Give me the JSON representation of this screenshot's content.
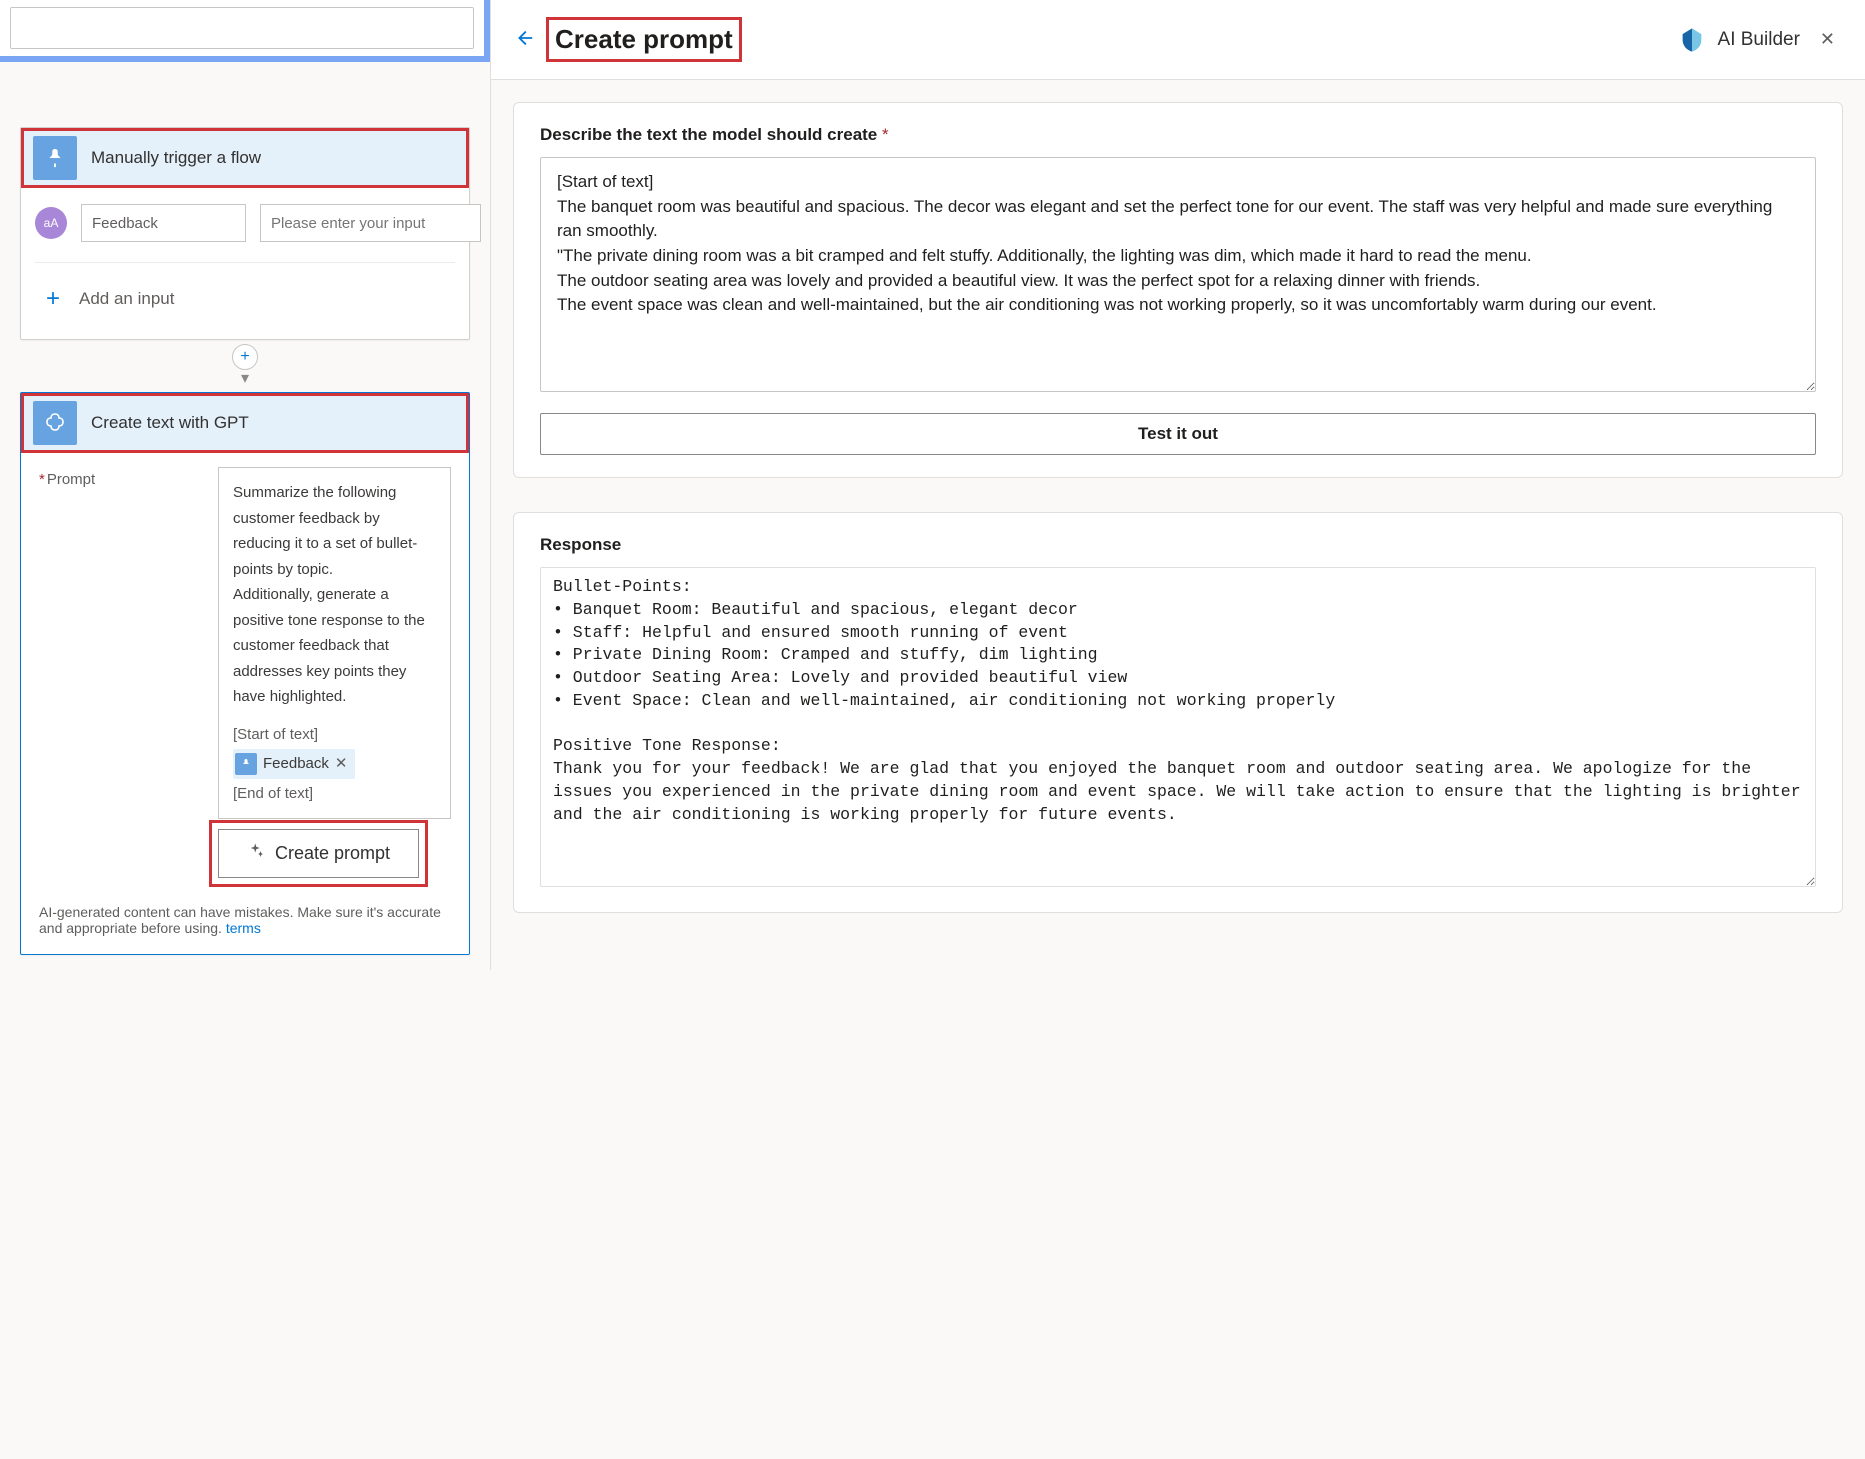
{
  "left": {
    "trigger": {
      "title": "Manually trigger a flow",
      "input_label": "Feedback",
      "input_placeholder": "Please enter your input",
      "add_input_label": "Add an input",
      "aa_badge": "aA"
    },
    "gpt": {
      "title": "Create text with GPT",
      "prompt_label": "Prompt",
      "prompt_text": "Summarize the following customer feedback by reducing it to a set of bullet-points by topic.\nAdditionally, generate a positive tone response to the customer feedback that addresses key points they have highlighted.",
      "start_marker": "[Start of text]",
      "end_marker": "[End of text]",
      "token_label": "Feedback",
      "create_prompt_label": "Create prompt",
      "disclaimer_text": "AI-generated content can have mistakes. Make sure it's accurate and appropriate before using.",
      "terms_label": "terms"
    }
  },
  "right": {
    "title": "Create prompt",
    "brand": "AI Builder",
    "desc_label": "Describe the text the model should create",
    "desc_value": "[Start of text]\nThe banquet room was beautiful and spacious. The decor was elegant and set the perfect tone for our event. The staff was very helpful and made sure everything ran smoothly.\n\"The private dining room was a bit cramped and felt stuffy. Additionally, the lighting was dim, which made it hard to read the menu.\nThe outdoor seating area was lovely and provided a beautiful view. It was the perfect spot for a relaxing dinner with friends.\nThe event space was clean and well-maintained, but the air conditioning was not working properly, so it was uncomfortably warm during our event.",
    "test_label": "Test it out",
    "response_label": "Response",
    "response_value": "Bullet-Points:\n• Banquet Room: Beautiful and spacious, elegant decor\n• Staff: Helpful and ensured smooth running of event\n• Private Dining Room: Cramped and stuffy, dim lighting\n• Outdoor Seating Area: Lovely and provided beautiful view\n• Event Space: Clean and well-maintained, air conditioning not working properly\n\nPositive Tone Response:\nThank you for your feedback! We are glad that you enjoyed the banquet room and outdoor seating area. We apologize for the issues you experienced in the private dining room and event space. We will take action to ensure that the lighting is brighter and the air conditioning is working properly for future events."
  }
}
